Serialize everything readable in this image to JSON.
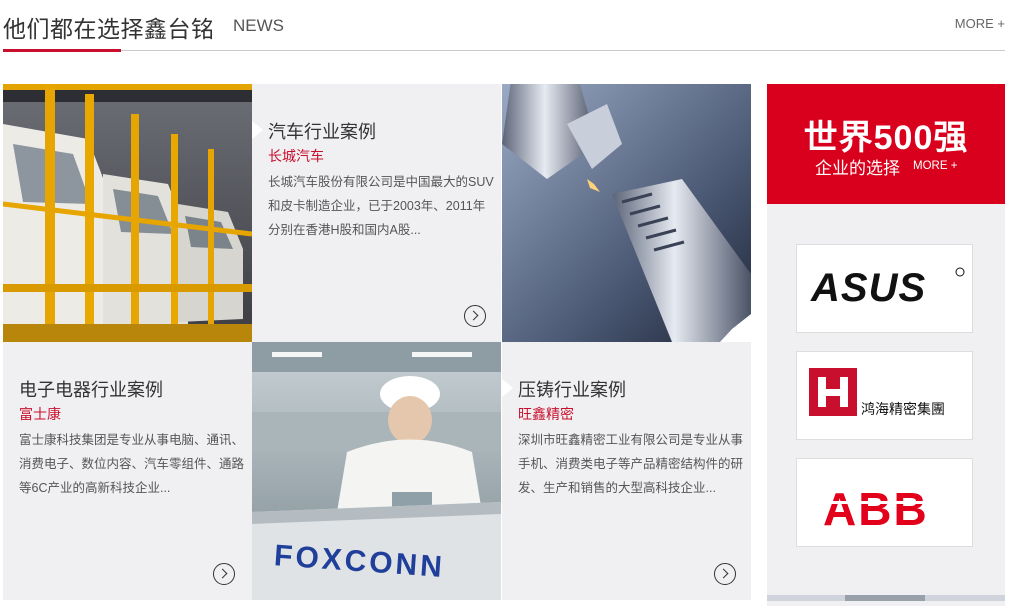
{
  "header": {
    "title": "他们都在选择鑫台铭",
    "subtitle": "NEWS",
    "more": "MORE +"
  },
  "cases": [
    {
      "title": "汽车行业案例",
      "brand": "长城汽车",
      "desc": "长城汽车股份有限公司是中国最大的SUV和皮卡制造企业，已于2003年、2011年分别在香港H股和国内A股..."
    },
    {
      "title": "电子电器行业案例",
      "brand": "富士康",
      "desc": "富士康科技集团是专业从事电脑、通讯、消费电子、数位内容、汽车零组件、通路等6C产业的高新科技企业..."
    },
    {
      "title": "压铸行业案例",
      "brand": "旺鑫精密",
      "desc": "深圳市旺鑫精密工业有限公司是专业从事手机、消费类电子等产品精密结构件的研发、生产和销售的大型高科技企业..."
    }
  ],
  "photos": {
    "foxconn_text": "FOXCONN"
  },
  "side": {
    "headline": "世界500强",
    "tagline": "企业的选择",
    "more": "MORE +",
    "logos": [
      {
        "name": "ASUS",
        "text": "ASUS"
      },
      {
        "name": "Hon Hai",
        "text": "鸿海精密集團"
      },
      {
        "name": "ABB",
        "text": "ABB"
      }
    ]
  },
  "colors": {
    "accent": "#c8102e",
    "banner": "#d8001c",
    "tile_bg": "#f0f0f2"
  }
}
